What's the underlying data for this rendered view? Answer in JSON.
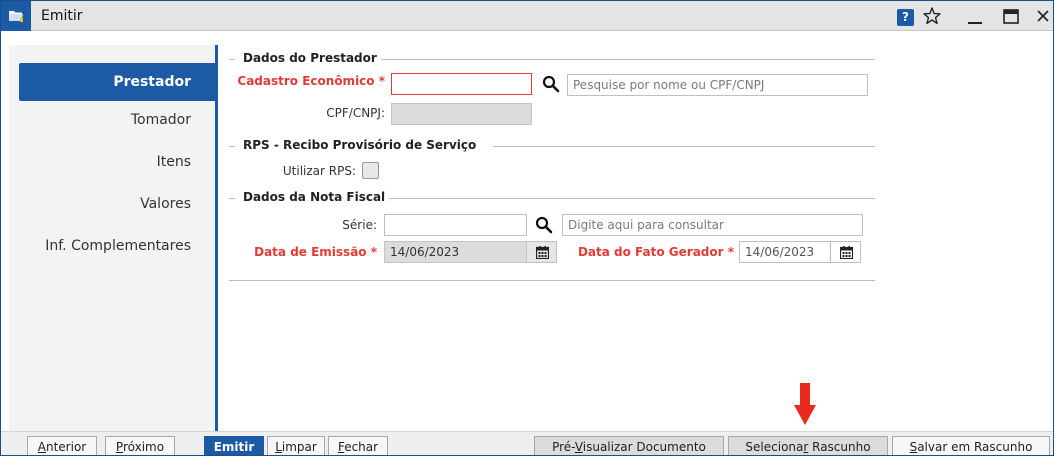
{
  "window": {
    "title": "Emitir"
  },
  "sidebar": {
    "items": [
      {
        "label": "Prestador",
        "active": true
      },
      {
        "label": "Tomador",
        "active": false
      },
      {
        "label": "Itens",
        "active": false
      },
      {
        "label": "Valores",
        "active": false
      },
      {
        "label": "Inf. Complementares",
        "active": false
      }
    ]
  },
  "prestador": {
    "legend": "Dados do Prestador",
    "cadastro_label": "Cadastro Econômico *",
    "cadastro_value": "",
    "search_placeholder": "Pesquise por nome ou CPF/CNPJ",
    "cpf_label": "CPF/CNPJ:",
    "cpf_value": ""
  },
  "rps": {
    "legend": "RPS - Recibo Provisório de Serviço",
    "utilizar_label": "Utilizar RPS:",
    "utilizar_checked": false
  },
  "nota": {
    "legend": "Dados da Nota Fiscal",
    "serie_label": "Série:",
    "serie_value": "",
    "serie_search_placeholder": "Digite aqui para consultar",
    "data_emissao_label": "Data de Emissão *",
    "data_emissao_value": "14/06/2023",
    "data_fato_label": "Data do Fato Gerador *",
    "data_fato_value": "14/06/2023"
  },
  "buttons": {
    "anterior": {
      "pre": "",
      "ul": "A",
      "post": "nterior"
    },
    "proximo": {
      "pre": "",
      "ul": "P",
      "post": "róximo"
    },
    "emitir": "Emitir",
    "limpar": {
      "pre": "",
      "ul": "L",
      "post": "impar"
    },
    "fechar": {
      "pre": "",
      "ul": "F",
      "post": "echar"
    },
    "pre_visualizar": {
      "pre": "Pré-",
      "ul": "V",
      "post": "isualizar Documento"
    },
    "selecionar": {
      "pre": "Seleciona",
      "ul": "r",
      "post": " Rascunho"
    },
    "salvar": {
      "pre": "",
      "ul": "S",
      "post": "alvar em Rascunho"
    }
  },
  "colors": {
    "accent": "#1c5aa6",
    "required": "#e23b35",
    "arrow": "#e8291c"
  },
  "icons": {
    "app": "folder-icon",
    "help": "help-icon",
    "favorite": "star-icon",
    "minimize": "minimize-icon",
    "maximize": "maximize-icon",
    "close": "close-icon",
    "search": "search-icon",
    "calendar": "calendar-icon",
    "annotation": "down-arrow-icon"
  },
  "help_glyph": "?"
}
